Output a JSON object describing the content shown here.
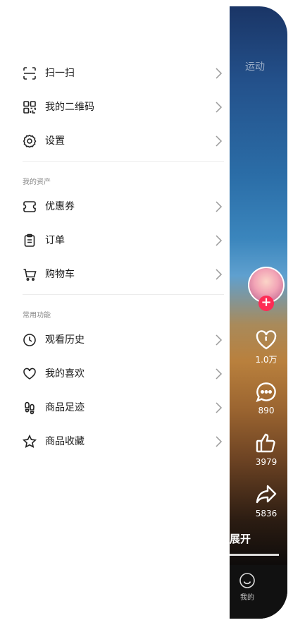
{
  "menu": {
    "top_items": [
      {
        "label": "扫一扫",
        "icon": "scan-icon"
      },
      {
        "label": "我的二维码",
        "icon": "qr-code-icon"
      },
      {
        "label": "设置",
        "icon": "gear-icon"
      }
    ],
    "assets_title": "我的资产",
    "asset_items": [
      {
        "label": "优惠券",
        "icon": "coupon-icon"
      },
      {
        "label": "订单",
        "icon": "clipboard-icon"
      },
      {
        "label": "购物车",
        "icon": "cart-icon"
      }
    ],
    "common_title": "常用功能",
    "common_items": [
      {
        "label": "观看历史",
        "icon": "clock-icon"
      },
      {
        "label": "我的喜欢",
        "icon": "heart-icon"
      },
      {
        "label": "商品足迹",
        "icon": "footprint-icon"
      },
      {
        "label": "商品收藏",
        "icon": "star-icon"
      }
    ]
  },
  "video": {
    "top_tab": "运动",
    "likes": "1.0万",
    "comments": "890",
    "thumbs": "3979",
    "shares": "5836",
    "expand_label": "展开",
    "bottom_tab": "我的",
    "follow_symbol": "+"
  },
  "colors": {
    "accent": "#fe2c55",
    "text": "#1a1a1a",
    "section": "#8a8a8a"
  }
}
